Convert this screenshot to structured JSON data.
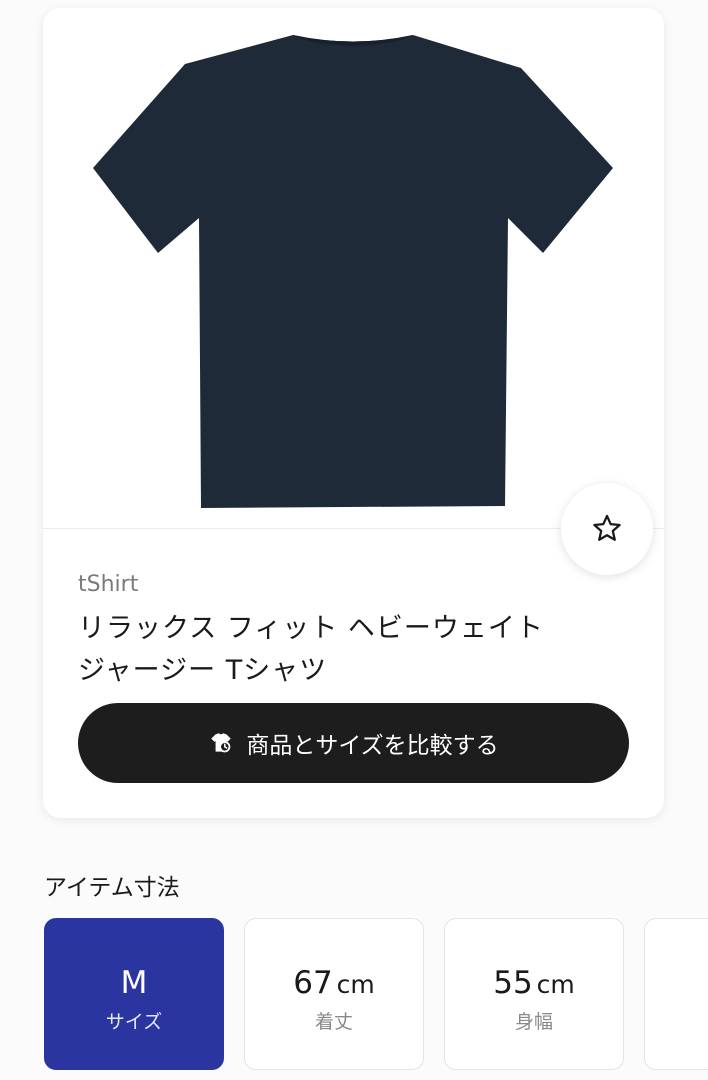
{
  "product": {
    "category": "tShirt",
    "title_line1": "リラックス フィット ヘビーウェイト",
    "title_line2": "ジャージー Tシャツ",
    "compare_label": "商品とサイズを比較する",
    "image_alt": "navy t-shirt",
    "shirt_color": "#1f2a38"
  },
  "icons": {
    "favorite": "star-outline-icon",
    "compare": "tshirt-icon"
  },
  "measurements": {
    "section_title": "アイテム寸法",
    "items": [
      {
        "value": "M",
        "unit": "",
        "label": "サイズ"
      },
      {
        "value": "67",
        "unit": "cm",
        "label": "着丈"
      },
      {
        "value": "55",
        "unit": "cm",
        "label": "身幅"
      }
    ]
  },
  "colors": {
    "accent": "#2b35a0",
    "button_bg": "#1d1d1d"
  }
}
